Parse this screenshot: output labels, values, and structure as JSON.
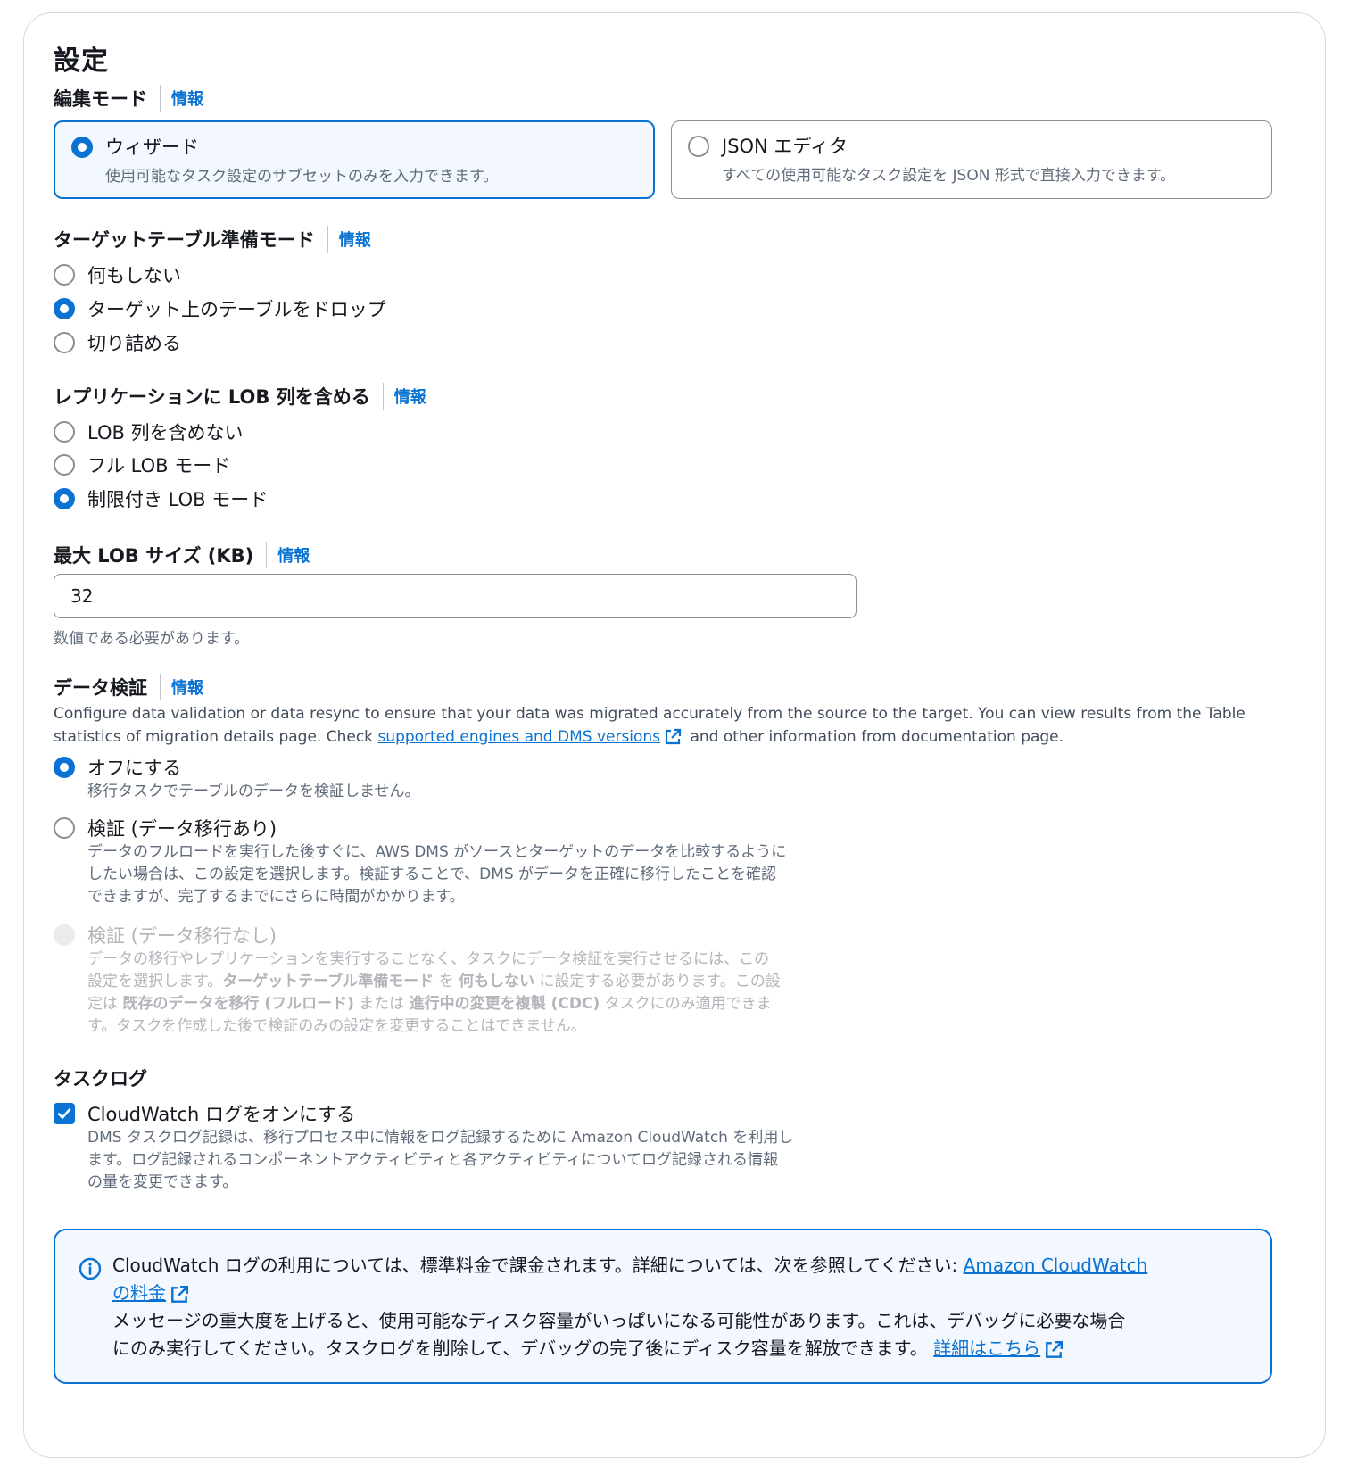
{
  "section": {
    "title": "設定",
    "info_label": "情報"
  },
  "edit_mode": {
    "label": "編集モード",
    "options": [
      {
        "title": "ウィザード",
        "description": "使用可能なタスク設定のサブセットのみを入力できます。",
        "selected": true
      },
      {
        "title": "JSON エディタ",
        "description": "すべての使用可能なタスク設定を JSON 形式で直接入力できます。",
        "selected": false
      }
    ]
  },
  "target_prep": {
    "label": "ターゲットテーブル準備モード",
    "options": [
      "何もしない",
      "ターゲット上のテーブルをドロップ",
      "切り詰める"
    ],
    "selected_index": 1
  },
  "lob": {
    "label": "レプリケーションに LOB 列を含める",
    "options": [
      "LOB 列を含めない",
      "フル LOB モード",
      "制限付き LOB モード"
    ],
    "selected_index": 2
  },
  "max_lob": {
    "label": "最大 LOB サイズ (KB)",
    "value": "32",
    "constraint": "数値である必要があります。"
  },
  "validation": {
    "label": "データ検証",
    "desc_1": "Configure data validation or data resync to ensure that your data was migrated accurately from the source to the target. You can view results from the Table statistics of migration details page. Check ",
    "desc_link": "supported engines and DMS versions",
    "desc_2": " and other information from documentation page.",
    "off": {
      "title": "オフにする",
      "description": "移行タスクでテーブルのデータを検証しません。"
    },
    "with_migration": {
      "title": "検証 (データ移行あり)",
      "description_lines": [
        "データのフルロードを実行した後すぐに、AWS DMS がソースとターゲットのデータを比較するように",
        "したい場合は、この設定を選択します。検証することで、DMS がデータを正確に移行したことを確認",
        "できますが、完了するまでにさらに時間がかかります。"
      ]
    },
    "without_migration": {
      "title": "検証 (データ移行なし)",
      "line1": "データの移行やレプリケーションを実行することなく、タスクにデータ検証を実行させるには、この",
      "line2_a": "設定を選択します。",
      "line2_b": "ターゲットテーブル準備モード",
      "line2_c": " を ",
      "line2_d": "何もしない",
      "line2_e": " に設定する必要があります。この設",
      "line3_a": "定は ",
      "line3_b": "既存のデータを移行 (フルロード)",
      "line3_c": " または ",
      "line3_d": "進行中の変更を複製 (CDC)",
      "line3_e": " タスクにのみ適用できま",
      "line4": "す。タスクを作成した後で検証のみの設定を変更することはできません。"
    },
    "selected": "off"
  },
  "task_log": {
    "label": "タスクログ",
    "checkbox_label": "CloudWatch ログをオンにする",
    "checked": true,
    "description_lines": [
      "DMS タスクログ記録は、移行プロセス中に情報をログ記録するために Amazon CloudWatch を利用し",
      "ます。ログ記録されるコンポーネントアクティビティと各アクティビティについてログ記録される情報",
      "の量を変更できます。"
    ]
  },
  "alert": {
    "line1_text": "CloudWatch ログの利用については、標準料金で課金されます。詳細については、次を参照してください: ",
    "line1_link_a": "Amazon CloudWatch",
    "line1_link_b": "の料金",
    "line2": "メッセージの重大度を上げると、使用可能なディスク容量がいっぱいになる可能性があります。これは、デバッグに必要な場合",
    "line3_text": "にのみ実行してください。タスクログを削除して、デバッグの完了後にディスク容量を解放できます。 ",
    "line3_link": "詳細はこちら"
  },
  "colors": {
    "accent": "#0972d3",
    "tile_selected_bg": "#f2f8fd",
    "secondary_text": "#5f6b7a",
    "disabled_text": "#b4b4bb"
  },
  "icons": {
    "external_link": "external-link-icon",
    "info": "info-circle-icon",
    "check": "check-icon"
  }
}
